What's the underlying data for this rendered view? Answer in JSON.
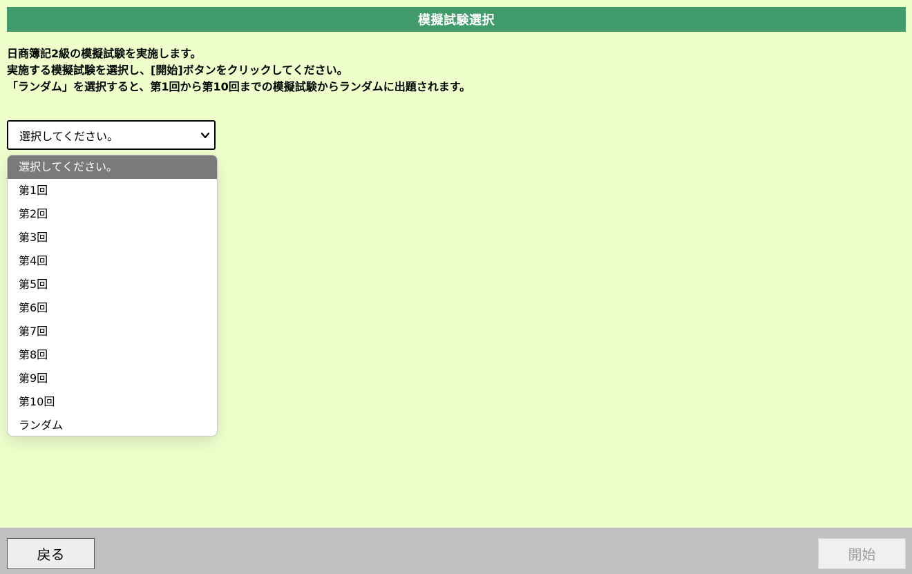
{
  "header": {
    "title": "模擬試験選択"
  },
  "instructions": {
    "line1": "日商簿記2級の模擬試験を実施します。",
    "line2": "実施する模擬試験を選択し、[開始]ボタンをクリックしてください。",
    "line3": "「ランダム」を選択すると、第1回から第10回までの模擬試験からランダムに出題されます。"
  },
  "exam_select": {
    "value": "選択してください。",
    "options": [
      "選択してください。",
      "第1回",
      "第2回",
      "第3回",
      "第4回",
      "第5回",
      "第6回",
      "第7回",
      "第8回",
      "第9回",
      "第10回",
      "ランダム"
    ],
    "highlighted_index": 0
  },
  "footer": {
    "back_label": "戻る",
    "start_label": "開始",
    "start_disabled": true
  },
  "colors": {
    "background": "#efffcc",
    "header": "#419b6a",
    "highlight": "#7a7a7a",
    "footer": "#c0c0c0"
  }
}
